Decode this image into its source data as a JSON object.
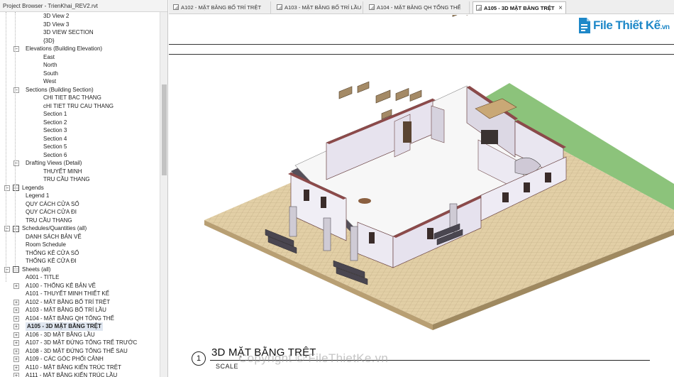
{
  "browser": {
    "title": "Project Browser - TrienKhai_REV2.rvt",
    "rows": [
      {
        "label": "3D View 2",
        "indent": 3,
        "toggle": ""
      },
      {
        "label": "3D View 3",
        "indent": 3,
        "toggle": ""
      },
      {
        "label": "3D VIEW SECTION",
        "indent": 3,
        "toggle": ""
      },
      {
        "label": "{3D}",
        "indent": 3,
        "toggle": ""
      },
      {
        "label": "Elevations (Building Elevation)",
        "indent": 2,
        "toggle": "−"
      },
      {
        "label": "East",
        "indent": 3,
        "toggle": ""
      },
      {
        "label": "North",
        "indent": 3,
        "toggle": ""
      },
      {
        "label": "South",
        "indent": 3,
        "toggle": ""
      },
      {
        "label": "West",
        "indent": 3,
        "toggle": ""
      },
      {
        "label": "Sections (Building Section)",
        "indent": 2,
        "toggle": "−"
      },
      {
        "label": "CHI TIET BAC THANG",
        "indent": 3,
        "toggle": ""
      },
      {
        "label": "cHI TIET TRU CAU THANG",
        "indent": 3,
        "toggle": ""
      },
      {
        "label": "Section 1",
        "indent": 3,
        "toggle": ""
      },
      {
        "label": "Section 2",
        "indent": 3,
        "toggle": ""
      },
      {
        "label": "Section 3",
        "indent": 3,
        "toggle": ""
      },
      {
        "label": "Section 4",
        "indent": 3,
        "toggle": ""
      },
      {
        "label": "Section 5",
        "indent": 3,
        "toggle": ""
      },
      {
        "label": "Section 6",
        "indent": 3,
        "toggle": ""
      },
      {
        "label": "Drafting Views (Detail)",
        "indent": 2,
        "toggle": "−"
      },
      {
        "label": "THUYẾT MINH",
        "indent": 3,
        "toggle": ""
      },
      {
        "label": "TRU CẦU THANG",
        "indent": 3,
        "toggle": ""
      },
      {
        "label": "Legends",
        "indent": 1,
        "toggle": "−",
        "icon": true
      },
      {
        "label": "Legend 1",
        "indent": 2,
        "toggle": ""
      },
      {
        "label": "QUY CÁCH CỬA SỔ",
        "indent": 2,
        "toggle": ""
      },
      {
        "label": "QUY CÁCH CỬA ĐI",
        "indent": 2,
        "toggle": ""
      },
      {
        "label": "TRU CẦU THANG",
        "indent": 2,
        "toggle": ""
      },
      {
        "label": "Schedules/Quantities (all)",
        "indent": 1,
        "toggle": "−",
        "icon": true
      },
      {
        "label": "DANH SÁCH BẢN VẼ",
        "indent": 2,
        "toggle": ""
      },
      {
        "label": "Room Schedule",
        "indent": 2,
        "toggle": ""
      },
      {
        "label": "THỐNG KÊ CỬA SỔ",
        "indent": 2,
        "toggle": ""
      },
      {
        "label": "THỐNG KÊ CỬA ĐI",
        "indent": 2,
        "toggle": ""
      },
      {
        "label": "Sheets (all)",
        "indent": 1,
        "toggle": "−",
        "icon": true
      },
      {
        "label": "A001 - TITLE",
        "indent": 2,
        "toggle": ""
      },
      {
        "label": "A100 - THỐNG KÊ BẢN VẼ",
        "indent": 2,
        "toggle": "+"
      },
      {
        "label": "A101 - THUYẾT MINH THIẾT KẾ",
        "indent": 2,
        "toggle": ""
      },
      {
        "label": "A102 - MẶT BẰNG BỐ TRÍ TRỆT",
        "indent": 2,
        "toggle": "+"
      },
      {
        "label": "A103 - MẶT BẰNG BỐ TRÍ LẦU",
        "indent": 2,
        "toggle": "+"
      },
      {
        "label": "A104 - MẶT BẰNG QH TỔNG THỂ",
        "indent": 2,
        "toggle": "+"
      },
      {
        "label": "A105 - 3D MẶT BẰNG TRỆT",
        "indent": 2,
        "toggle": "+",
        "selected": true
      },
      {
        "label": "A106 - 3D MẶT BẰNG LẦU",
        "indent": 2,
        "toggle": "+"
      },
      {
        "label": "A107 - 3D MẶT ĐỨNG TỔNG TRỂ TRƯỚC",
        "indent": 2,
        "toggle": "+"
      },
      {
        "label": "A108 - 3D MẶT ĐỨNG TỔNG THỂ SAU",
        "indent": 2,
        "toggle": "+"
      },
      {
        "label": "A109 - CÁC GÓC PHỐI CẢNH",
        "indent": 2,
        "toggle": "+"
      },
      {
        "label": "A110 - MẶT BẰNG KIẾN TRÚC TRỆT",
        "indent": 2,
        "toggle": "+"
      },
      {
        "label": "A111 - MẶT BẰNG KIẾN TRÚC LẦU",
        "indent": 2,
        "toggle": "+"
      }
    ]
  },
  "tabs": [
    {
      "label": "A102 - MẶT BẰNG BỐ TRÍ TRỆT",
      "active": false
    },
    {
      "label": "A103 - MẶT BẰNG BỐ TRÍ LẦU",
      "active": false
    },
    {
      "label": "A104 - MẶT BẰNG QH TỔNG THỂ",
      "active": false
    },
    {
      "label": "A105 - 3D MẶT BẰNG TRỆT",
      "active": true
    }
  ],
  "tab_close_glyph": "×",
  "logo": {
    "brand": "File Thiết Kế",
    "suffix": ".vn"
  },
  "viewport": {
    "view_number": "1",
    "view_title": "3D MẶT BẰNG TRỆT",
    "scale_label": "SCALE",
    "watermark": "Copyright © FileThietKe.vn"
  },
  "colors": {
    "grass": "#8cc37b",
    "paving": "#e2cfa6",
    "wall_cap": "#8c4a4a",
    "wall_face": "#ece9f2",
    "floor": "#f7f7f7",
    "brand": "#1e88c8"
  }
}
